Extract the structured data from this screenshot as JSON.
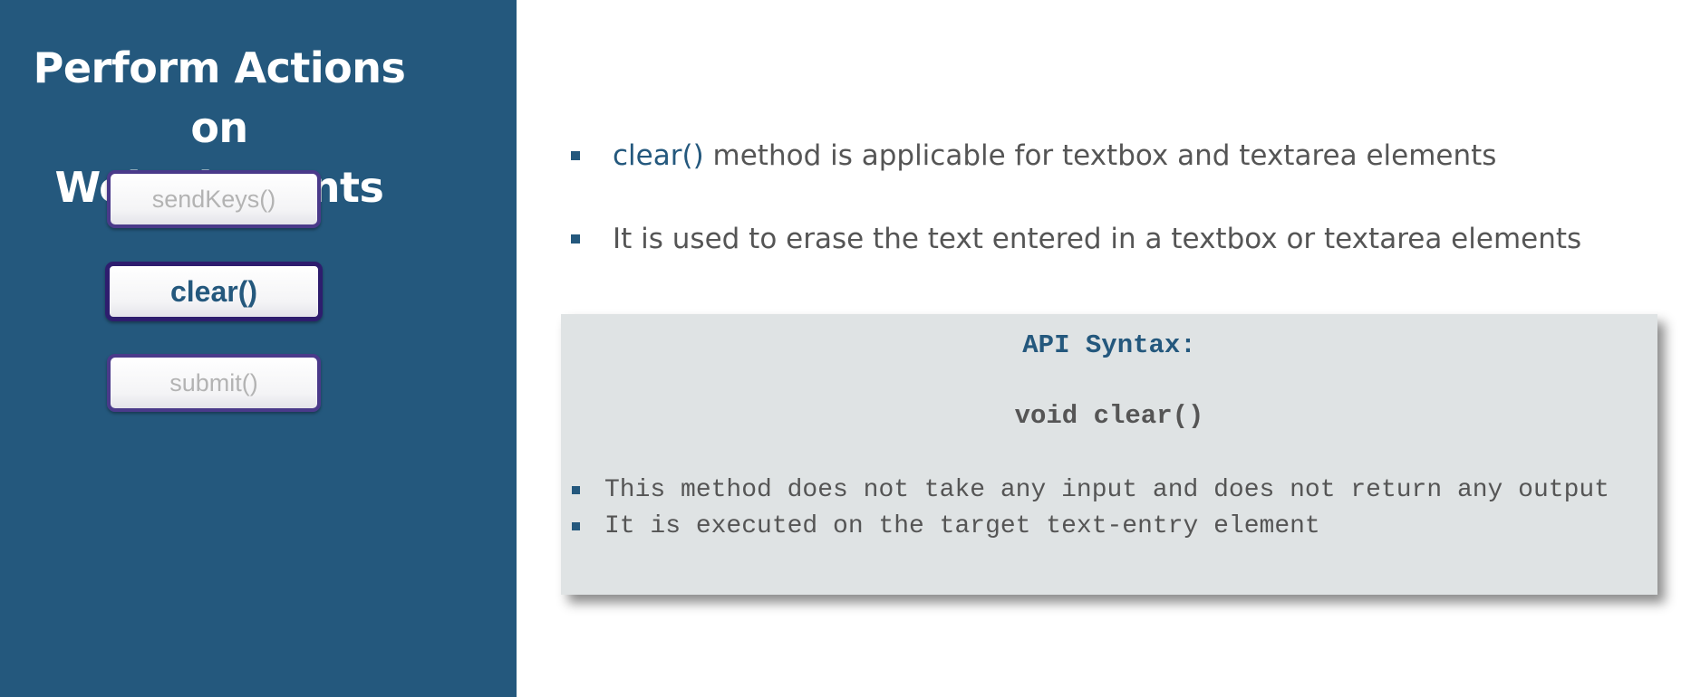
{
  "slide": {
    "title_line1": "Perform Actions on",
    "title_line2": "Web Elements",
    "methods": [
      {
        "label": "sendKeys()",
        "state": "inactive"
      },
      {
        "label": "clear()",
        "state": "active"
      },
      {
        "label": "submit()",
        "state": "inactive"
      }
    ]
  },
  "content": {
    "bullets": [
      {
        "highlight": "clear()",
        "text": " method is applicable for textbox and textarea elements"
      },
      {
        "highlight": "",
        "text": "It is used to erase the text entered in a textbox or textarea elements"
      }
    ],
    "syntax": {
      "heading": "API Syntax:",
      "signature": "void clear()",
      "points": [
        "This method does not take any input and does not return any output",
        "It is executed on the target text-entry element"
      ]
    }
  },
  "colors": {
    "panel_bg": "#24587d",
    "accent": "#24587d",
    "text_gray": "#555555",
    "syntax_box_bg": "#dfe3e4",
    "button_border": "#3b2a78"
  }
}
